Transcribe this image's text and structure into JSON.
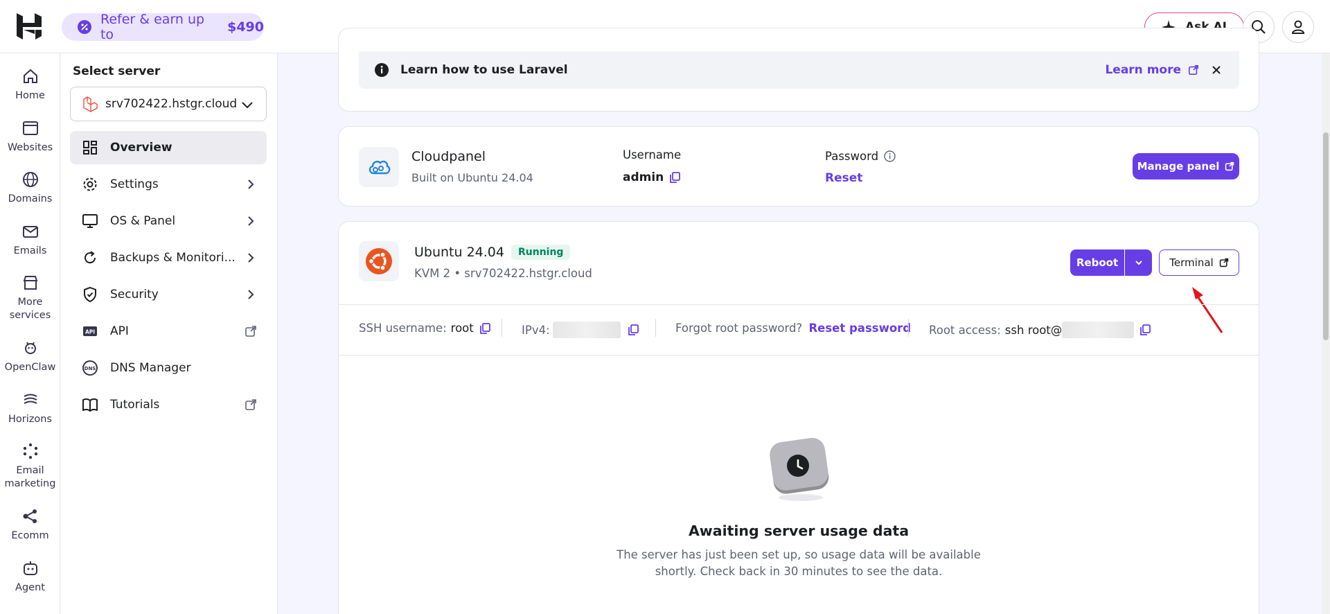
{
  "header": {
    "refer_text": "Refer & earn up to",
    "refer_amount": "$490",
    "ask_ai": "Ask AI"
  },
  "rail": [
    {
      "label": "Home",
      "icon": "home-icon"
    },
    {
      "label": "Websites",
      "icon": "browser-icon"
    },
    {
      "label": "Domains",
      "icon": "globe-icon"
    },
    {
      "label": "Emails",
      "icon": "mail-icon"
    },
    {
      "label": "More services",
      "icon": "store-icon"
    },
    {
      "label": "OpenClaw",
      "icon": "claw-icon"
    },
    {
      "label": "Horizons",
      "icon": "horizons-icon"
    },
    {
      "label": "Email marketing",
      "icon": "email-marketing-icon"
    },
    {
      "label": "Ecomm",
      "icon": "ecommerce-icon"
    },
    {
      "label": "Agent",
      "icon": "agent-icon"
    }
  ],
  "subnav": {
    "select_label": "Select server",
    "server_name": "srv702422.hstgr.cloud",
    "items": [
      {
        "label": "Overview",
        "icon": "grid-icon",
        "trail": "none"
      },
      {
        "label": "Settings",
        "icon": "gear-icon",
        "trail": "chevron"
      },
      {
        "label": "OS & Panel",
        "icon": "monitor-icon",
        "trail": "chevron"
      },
      {
        "label": "Backups & Monitori...",
        "icon": "refresh-icon",
        "trail": "chevron"
      },
      {
        "label": "Security",
        "icon": "shield-icon",
        "trail": "chevron"
      },
      {
        "label": "API",
        "icon": "api-icon",
        "trail": "external"
      },
      {
        "label": "DNS Manager",
        "icon": "dns-icon",
        "trail": "none"
      },
      {
        "label": "Tutorials",
        "icon": "book-icon",
        "trail": "external"
      }
    ]
  },
  "banner": {
    "text": "Learn how to use Laravel",
    "learn_more": "Learn more"
  },
  "panel": {
    "name": "Cloudpanel",
    "built_on": "Built on Ubuntu 24.04",
    "username_label": "Username",
    "username": "admin",
    "password_label": "Password",
    "reset": "Reset",
    "manage": "Manage panel"
  },
  "server": {
    "os": "Ubuntu 24.04",
    "status": "Running",
    "plan": "KVM 2 • srv702422.hstgr.cloud",
    "reboot": "Reboot",
    "terminal": "Terminal",
    "ssh_label": "SSH username:",
    "ssh_value": "root",
    "ipv4_label": "IPv4:",
    "forgot_label": "Forgot root password?",
    "reset_password": "Reset password",
    "root_label": "Root access:",
    "root_value": "ssh root@"
  },
  "usage": {
    "title": "Awaiting server usage data",
    "line1": "The server has just been set up, so usage data will be available",
    "line2": "shortly. Check back in 30 minutes to see the data."
  },
  "colors": {
    "accent": "#673de6",
    "running": "#008361",
    "annotation": "#e5141b"
  }
}
